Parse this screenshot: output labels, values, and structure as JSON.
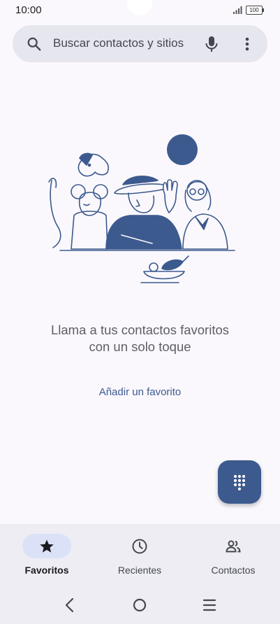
{
  "status_bar": {
    "time": "10:00",
    "battery": "100"
  },
  "search": {
    "placeholder": "Buscar contactos y sitios",
    "icon": "search-icon",
    "mic_icon": "mic-icon",
    "menu_icon": "more-vert-icon"
  },
  "empty_state": {
    "message": "Llama a tus contactos favoritos con un solo toque",
    "action": "Añadir un favorito"
  },
  "fab": {
    "icon": "dialpad-icon"
  },
  "bottom_nav": {
    "items": [
      {
        "label": "Favoritos",
        "icon": "star-icon",
        "active": true
      },
      {
        "label": "Recientes",
        "icon": "clock-icon",
        "active": false
      },
      {
        "label": "Contactos",
        "icon": "people-icon",
        "active": false
      }
    ]
  },
  "system_nav": [
    "back-icon",
    "home-icon",
    "recents-icon"
  ],
  "colors": {
    "background": "#fbf8fd",
    "accent": "#3c5a8e",
    "search_bg": "#e6e6ee",
    "nav_bg": "#eeedf4",
    "active_pill": "#dbe2f8"
  }
}
